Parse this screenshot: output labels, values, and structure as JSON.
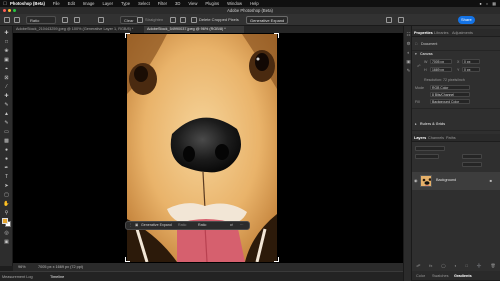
{
  "menubar": {
    "apple": "",
    "items": [
      "Photoshop (Beta)",
      "File",
      "Edit",
      "Image",
      "Layer",
      "Type",
      "Select",
      "Filter",
      "3D",
      "View",
      "Plugins",
      "Window",
      "Help"
    ]
  },
  "window": {
    "title": "Adobe Photoshop (Beta)"
  },
  "options_bar": {
    "ratio_label": "Ratio",
    "clear_label": "Clear",
    "straighten_label": "Straighten",
    "delete_cropped_label": "Delete Cropped Pixels",
    "fill_dropdown": "Generative Expand",
    "share_label": "Share"
  },
  "tabs": [
    {
      "label": "AdobeStock_210443259.jpeg @ 100% (Generative Layer 1, RGB/8) *"
    },
    {
      "label": "AdobeStock_54990037.jpeg @ 96% (RGB/8) *"
    }
  ],
  "context_bar": {
    "generative_expand": "Generative Expand",
    "ratio_dropdown": "Ratio",
    "ratio_value": "Ratio"
  },
  "status_bar": {
    "zoom": "96%",
    "doc_size": "7005 px x 1669 px (72 ppi)"
  },
  "bottom_tabs": [
    "Measurement Log",
    "Timeline"
  ],
  "properties": {
    "tabs": [
      "Properties",
      "Libraries",
      "Adjustments"
    ],
    "document_label": "Document",
    "canvas_section": "Canvas",
    "width_label": "W",
    "width_value": "7005 px",
    "height_label": "H",
    "height_value": "1669 px",
    "x_label": "X",
    "x_value": "0 px",
    "y_label": "Y",
    "y_value": "0 px",
    "resolution": "Resolution: 72 pixels/inch",
    "mode_label": "Mode",
    "mode_value": "RGB Color",
    "depth_value": "8 Bits/Channel",
    "fill_label": "Fill",
    "fill_value": "Background Color",
    "rulers_section": "Rulers & Grids"
  },
  "layers_panel": {
    "tabs": [
      "Layers",
      "Channels",
      "Paths"
    ],
    "layer_name": "Background"
  },
  "bottom_right_tabs": [
    "Color",
    "Swatches",
    "Gradients"
  ],
  "colors": {
    "accent": "#1473e6",
    "foreground": "#e5a630",
    "background": "#ffffff"
  }
}
